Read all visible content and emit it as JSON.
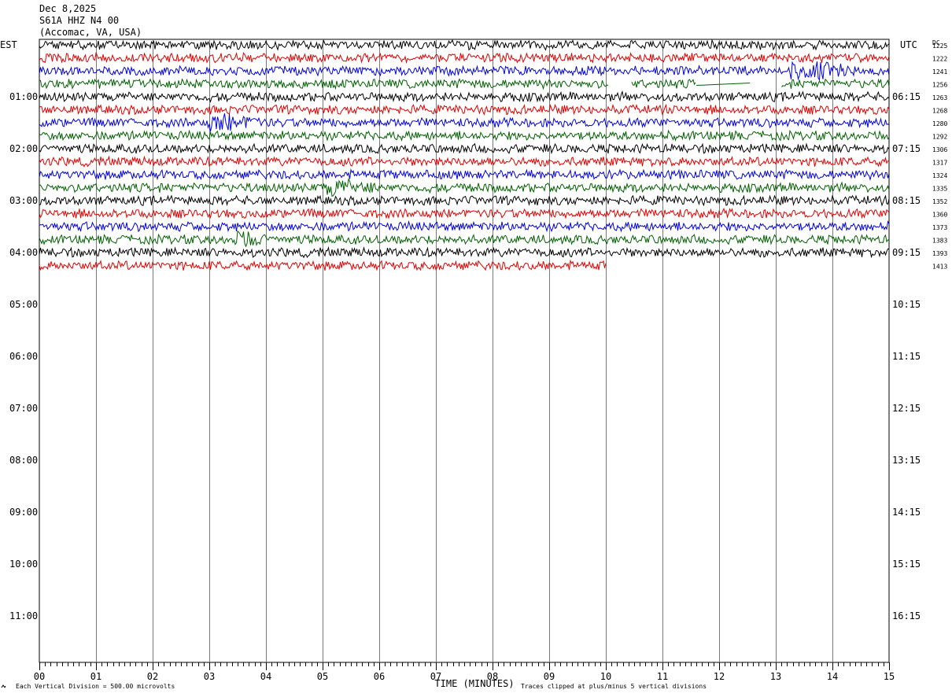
{
  "header": {
    "date": "Dec 8,2025",
    "station": "S61A HHZ N4 00",
    "location": "(Accomac, VA, USA)"
  },
  "left_axis_label": "EST",
  "right_axis_label": "UTC",
  "dc_label": "DC",
  "footer": {
    "scale_note": "Each Vertical Division =  500.00 microvolts",
    "xaxis_title": "TIME (MINUTES)",
    "clip_note": "Traces clipped at plus/minus 5 vertical divisions"
  },
  "chart_data": {
    "type": "line",
    "title": "S61A HHZ N4 00",
    "xlabel": "TIME (MINUTES)",
    "xlim": [
      0,
      15
    ],
    "x_tick_labels": [
      "00",
      "01",
      "02",
      "03",
      "04",
      "05",
      "06",
      "07",
      "08",
      "09",
      "10",
      "11",
      "12",
      "13",
      "14",
      "15"
    ],
    "left_hour_labels": [
      "01:00",
      "02:00",
      "03:00",
      "04:00",
      "05:00",
      "06:00",
      "07:00",
      "08:00",
      "09:00",
      "10:00",
      "11:00"
    ],
    "right_hour_labels": [
      "06:15",
      "07:15",
      "08:15",
      "09:15",
      "10:15",
      "11:15",
      "12:15",
      "13:15",
      "14:15",
      "15:15",
      "16:15"
    ],
    "trace_colors": [
      "#000000",
      "#e00000",
      "#0000e0",
      "#006000"
    ],
    "dc_values": [
      "1225",
      "1222",
      "1241",
      "1256",
      "1263",
      "1268",
      "1280",
      "1292",
      "1306",
      "1317",
      "1324",
      "1335",
      "1352",
      "1360",
      "1373",
      "1383",
      "1393",
      "1413"
    ],
    "traces": [
      {
        "row": 0,
        "end_min": 15
      },
      {
        "row": 1,
        "end_min": 15
      },
      {
        "row": 2,
        "end_min": 15,
        "events": [
          {
            "start": 13.2,
            "end": 14.4,
            "amp": 2.2
          }
        ]
      },
      {
        "row": 3,
        "end_min": 15,
        "gaps": [
          [
            10.05,
            10.45
          ],
          [
            11.6,
            13.1
          ]
        ]
      },
      {
        "row": 4,
        "end_min": 15
      },
      {
        "row": 5,
        "end_min": 15
      },
      {
        "row": 6,
        "end_min": 15,
        "events": [
          {
            "start": 2.95,
            "end": 3.9,
            "amp": 2.6
          }
        ]
      },
      {
        "row": 7,
        "end_min": 15
      },
      {
        "row": 8,
        "end_min": 15
      },
      {
        "row": 9,
        "end_min": 15
      },
      {
        "row": 10,
        "end_min": 15
      },
      {
        "row": 11,
        "end_min": 15,
        "events": [
          {
            "start": 5.0,
            "end": 6.0,
            "amp": 1.8
          }
        ]
      },
      {
        "row": 12,
        "end_min": 15
      },
      {
        "row": 13,
        "end_min": 15
      },
      {
        "row": 14,
        "end_min": 15
      },
      {
        "row": 15,
        "end_min": 15,
        "events": [
          {
            "start": 3.4,
            "end": 4.1,
            "amp": 1.9
          }
        ]
      },
      {
        "row": 16,
        "end_min": 15
      },
      {
        "row": 17,
        "end_min": 10
      }
    ]
  }
}
